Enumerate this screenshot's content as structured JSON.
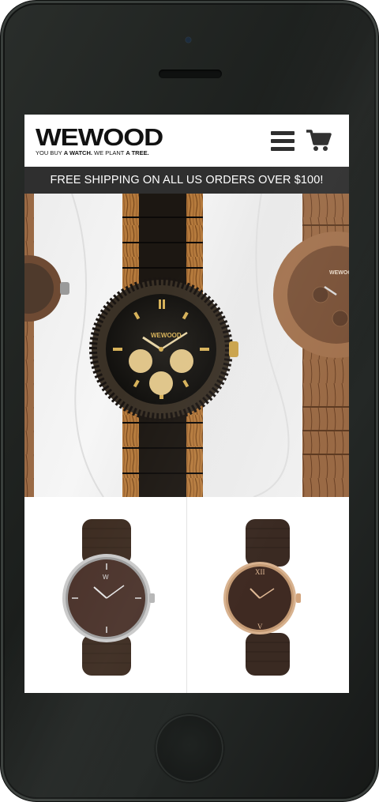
{
  "brand": {
    "logo_text": "WEWOOD",
    "tagline_parts": [
      "YOU BUY ",
      "A WATCH.",
      " WE PLANT ",
      "A TREE."
    ]
  },
  "header": {
    "menu_icon": "hamburger-menu-icon",
    "cart_icon": "shopping-cart-icon"
  },
  "banner": {
    "text": "FREE SHIPPING ON ALL US ORDERS OVER $100!"
  },
  "hero": {
    "image": "wooden-watches-hero"
  },
  "products": [
    {
      "image": "silver-case-wood-watch"
    },
    {
      "image": "rose-gold-case-wood-watch"
    }
  ],
  "colors": {
    "banner_bg": "#2f2f2f",
    "banner_text": "#ffffff",
    "header_bg": "#ffffff",
    "phone_body": "#1e2120"
  }
}
